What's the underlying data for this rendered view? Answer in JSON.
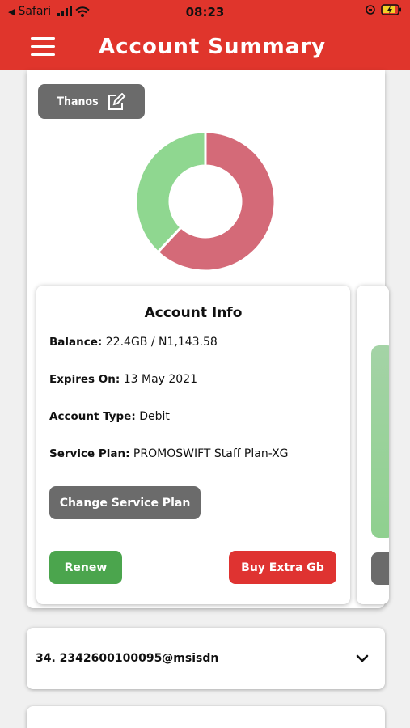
{
  "status_bar": {
    "carrier": "Safari",
    "time": "08:23"
  },
  "header": {
    "title": "Account Summary"
  },
  "profile": {
    "name": "Thanos"
  },
  "chart_data": {
    "type": "pie",
    "donut": true,
    "values": [
      62,
      38
    ],
    "colors": [
      "#d46a78",
      "#8fd790"
    ]
  },
  "account_info": {
    "title": "Account Info",
    "balance_label": "Balance:",
    "balance_value": "22.4GB / N1,143.58",
    "expires_label": "Expires On:",
    "expires_value": "13 May 2021",
    "type_label": "Account Type:",
    "type_value": "Debit",
    "plan_label": "Service Plan:",
    "plan_value": "PROMOSWIFT Staff Plan-XG",
    "change_plan_button": "Change Service Plan",
    "renew_button": "Renew",
    "buy_button": "Buy Extra Gb"
  },
  "account_list": {
    "item": "34. 2342600100095@msisdn"
  },
  "colors": {
    "brand_red": "#e0352c",
    "renew_green": "#4ba54d",
    "buy_red": "#df3331",
    "button_gray": "#6b6b6b"
  }
}
